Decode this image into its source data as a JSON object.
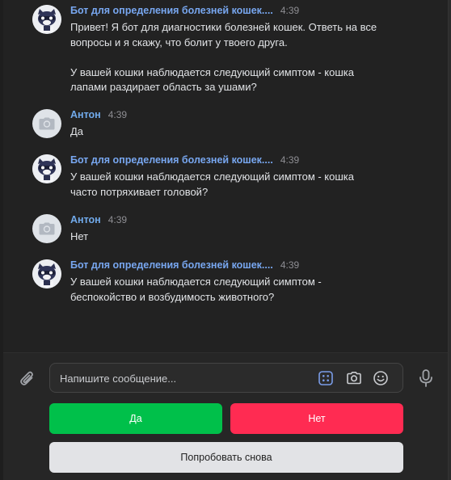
{
  "messages": [
    {
      "author": "Бот для определения болезней кошек....",
      "time": "4:39",
      "text": "Привет! Я бот для диагностики болезней кошек. Ответь на все\nвопросы и я скажу, что болит у твоего друга.\n\nУ вашей кошки наблюдается следующий симптом - кошка\nлапами раздирает область за ушами?"
    },
    {
      "author": "Антон",
      "time": "4:39",
      "text": "Да"
    },
    {
      "author": "Бот для определения болезней кошек....",
      "time": "4:39",
      "text": "У вашей кошки наблюдается следующий симптом - кошка\nчасто потряхивает головой?"
    },
    {
      "author": "Антон",
      "time": "4:39",
      "text": "Нет"
    },
    {
      "author": "Бот для определения болезней кошек....",
      "time": "4:39",
      "text": "У вашей кошки наблюдается следующий симптом -\nбеспокойство и возбудимость животного?"
    }
  ],
  "composer": {
    "placeholder": "Напишите сообщение...",
    "icons": [
      "paperclip-icon",
      "keyboard-grid-icon",
      "camera-icon",
      "emoji-icon",
      "microphone-icon"
    ]
  },
  "keyboard": {
    "yes_label": "Да",
    "no_label": "Нет",
    "retry_label": "Попробовать снова"
  },
  "colors": {
    "background": "#222222",
    "author_link": "#78a7f0",
    "yes_button": "#00c04a",
    "no_button": "#ff2b52",
    "retry_button": "#e2e3e6"
  }
}
